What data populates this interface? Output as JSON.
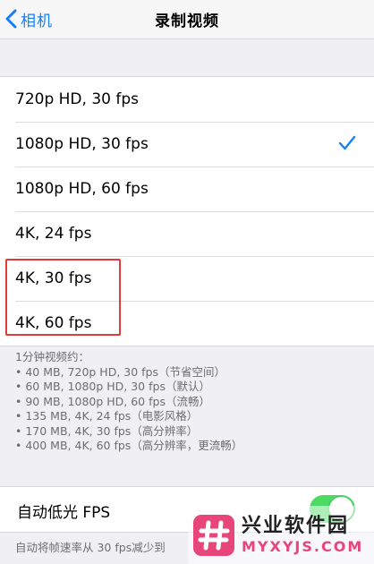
{
  "nav": {
    "back_label": "相机",
    "title": "录制视频"
  },
  "options": [
    {
      "label": "720p HD, 30 fps",
      "selected": false
    },
    {
      "label": "1080p HD, 30 fps",
      "selected": true
    },
    {
      "label": "1080p HD, 60 fps",
      "selected": false
    },
    {
      "label": "4K, 24 fps",
      "selected": false
    },
    {
      "label": "4K, 30 fps",
      "selected": false
    },
    {
      "label": "4K, 60 fps",
      "selected": false
    }
  ],
  "footnote": {
    "heading": "1分钟视频约：",
    "lines": [
      "• 40 MB, 720p HD, 30 fps（节省空间）",
      "• 60 MB, 1080p HD, 30 fps（默认）",
      "• 90 MB, 1080p HD, 60 fps（流畅）",
      "• 135 MB, 4K, 24 fps（电影风格）",
      "• 170 MB, 4K, 30 fps（高分辨率）",
      "• 400 MB, 4K, 60 fps（高分辨率，更流畅）"
    ]
  },
  "low_light": {
    "label": "自动低光 FPS",
    "enabled": true
  },
  "bottom_note": "自动将帧速率从 30 fps减少到",
  "watermark": {
    "name": "兴业软件园",
    "domain": "MYXYJS.COM"
  },
  "colors": {
    "accent": "#157efb",
    "toggle_on": "#4cd964",
    "highlight": "#e23a35"
  }
}
